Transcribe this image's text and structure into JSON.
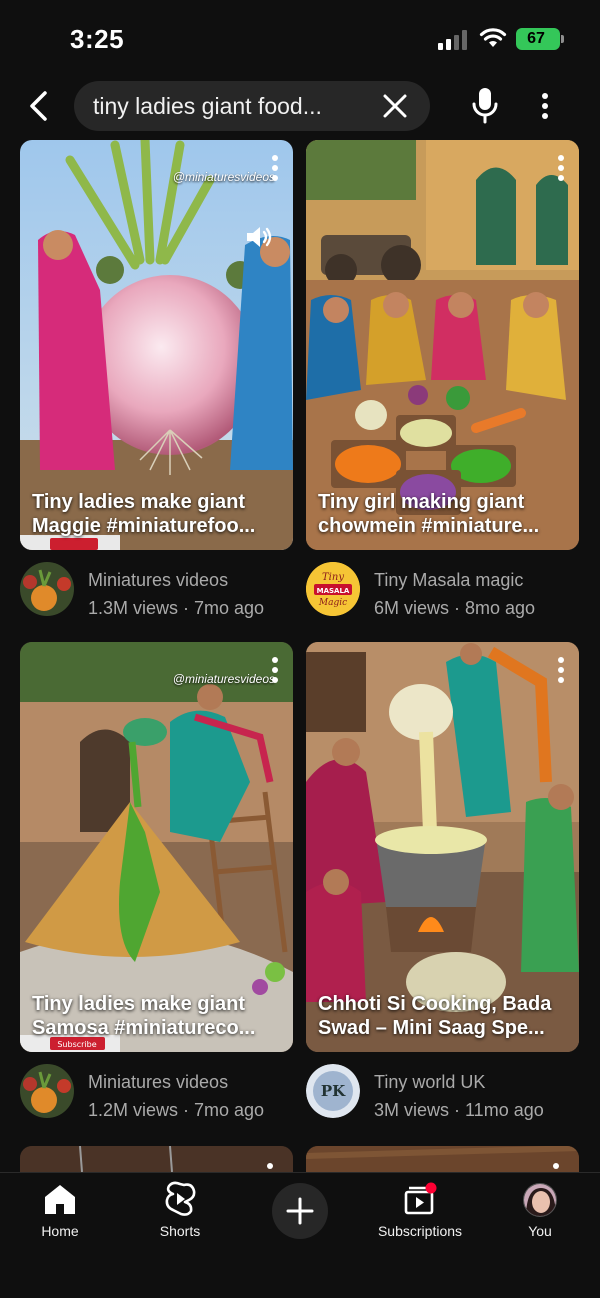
{
  "status_bar": {
    "time": "3:25",
    "battery": "67"
  },
  "search": {
    "query": "tiny ladies giant food..."
  },
  "videos": [
    {
      "title": "Tiny ladies make giant\nMaggie #miniaturefoo...",
      "channel": "Miniatures videos",
      "stats": "1.3M views · 7mo ago",
      "watermark": "@miniaturesvideos"
    },
    {
      "title": "Tiny girl making giant\nchowmein #miniature...",
      "channel": "Tiny Masala magic",
      "stats": "6M views · 8mo ago",
      "avatar_text": "Tiny MASALA Magic"
    },
    {
      "title": "Tiny ladies make giant\nSamosa #miniatureco...",
      "channel": "Miniatures videos",
      "stats": "1.2M views · 7mo ago",
      "watermark": "@miniaturesvideos",
      "subscribe_label": "Subscribe"
    },
    {
      "title": "Chhoti Si Cooking, Bada\nSwad – Mini Saag Spe...",
      "channel": "Tiny world UK",
      "stats": "3M views · 11mo ago",
      "avatar_text": "PK"
    }
  ],
  "nav": {
    "home": "Home",
    "shorts": "Shorts",
    "subscriptions": "Subscriptions",
    "you": "You"
  },
  "colors": {
    "background": "#0f0f0f",
    "search_bg": "#272727",
    "battery": "#34c759",
    "badge": "#ff0033"
  }
}
